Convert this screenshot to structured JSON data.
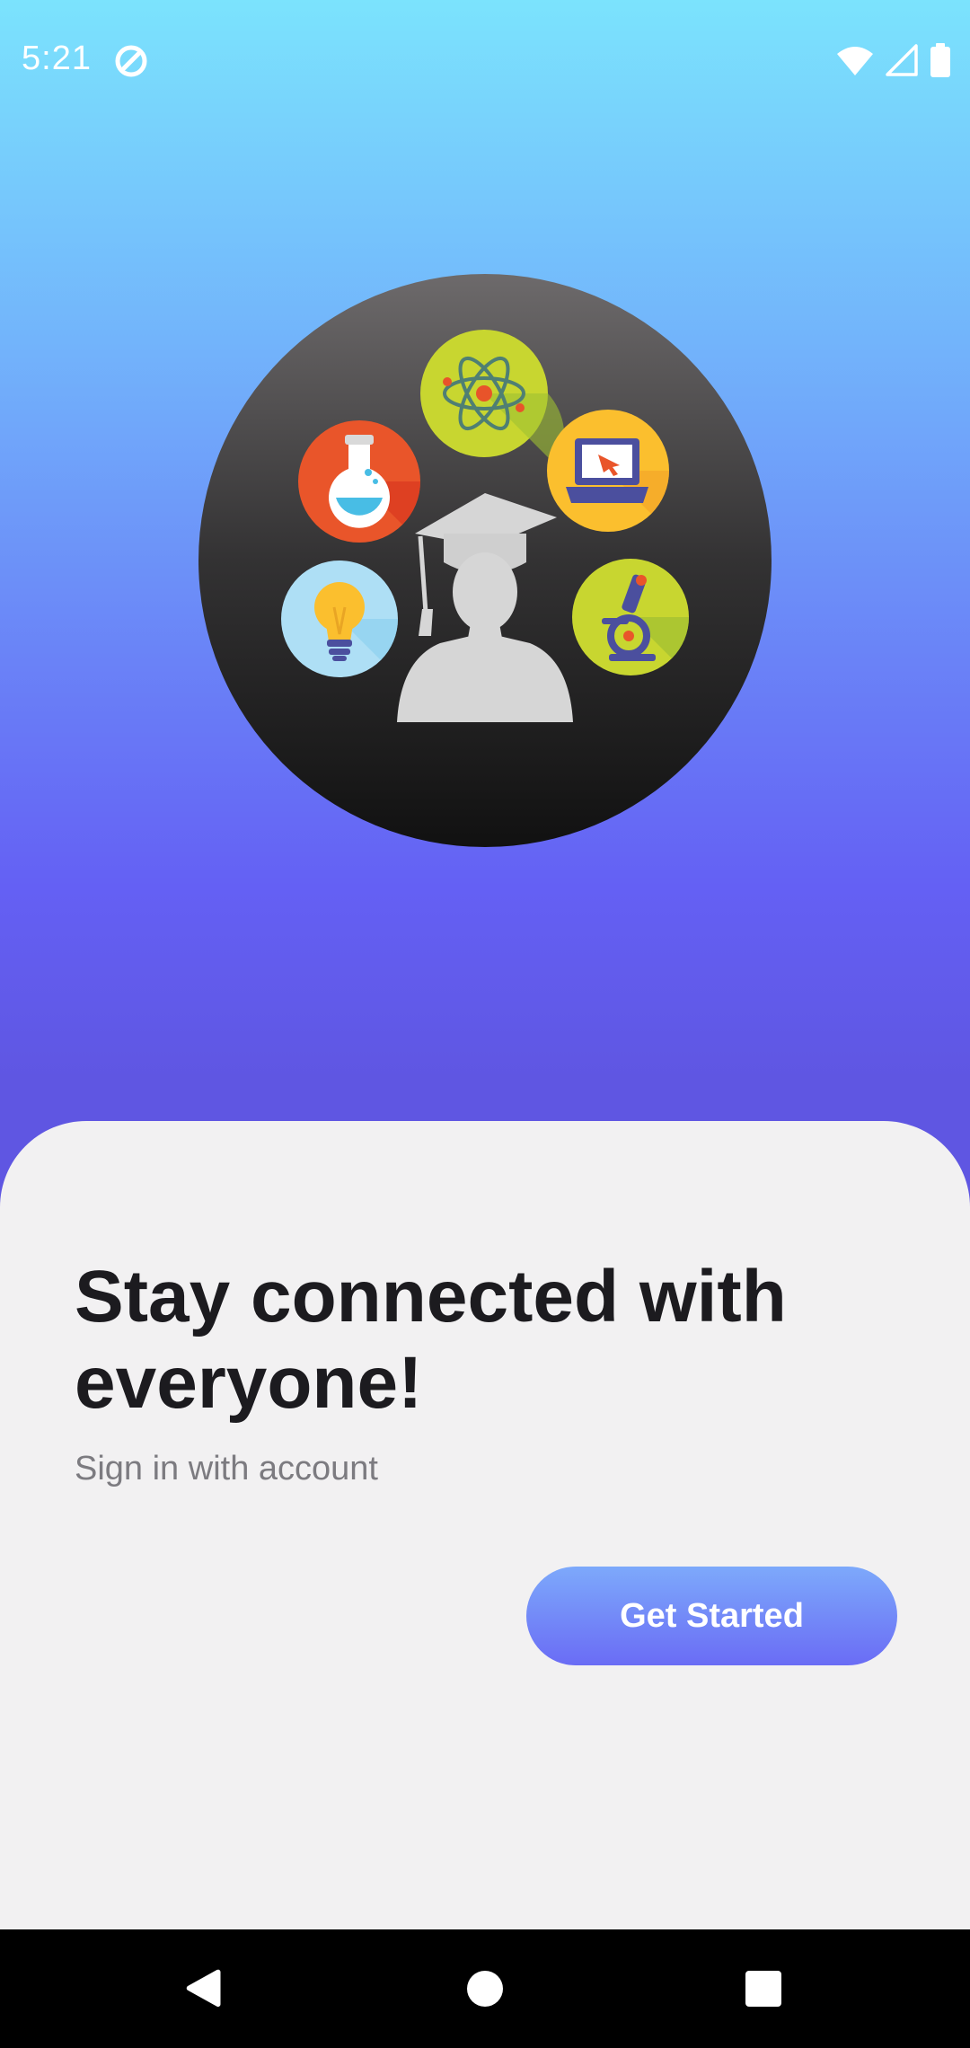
{
  "status_bar": {
    "time": "5:21",
    "icons": [
      "data-saver-icon",
      "wifi-icon",
      "cellular-signal-icon",
      "battery-icon"
    ]
  },
  "hero": {
    "image": "graduate-with-science-icons-illustration",
    "icons": [
      "atom-icon",
      "flask-icon",
      "laptop-icon",
      "light-bulb-icon",
      "microscope-icon",
      "graduate-silhouette-icon"
    ]
  },
  "onboarding": {
    "headline": "Stay connected with everyone!",
    "subtitle": "Sign in with account",
    "cta_label": "Get Started"
  },
  "nav_bar": {
    "icons": [
      "back-icon",
      "home-icon",
      "recents-icon"
    ]
  },
  "colors": {
    "gradient_top": "#7be3fd",
    "gradient_bottom": "#5f56e2",
    "card_bg": "#f2f1f2",
    "headline": "#1c1b1f",
    "subtitle": "#7c7b80",
    "button_top": "#7da9fb",
    "button_bottom": "#6a6cf5"
  }
}
